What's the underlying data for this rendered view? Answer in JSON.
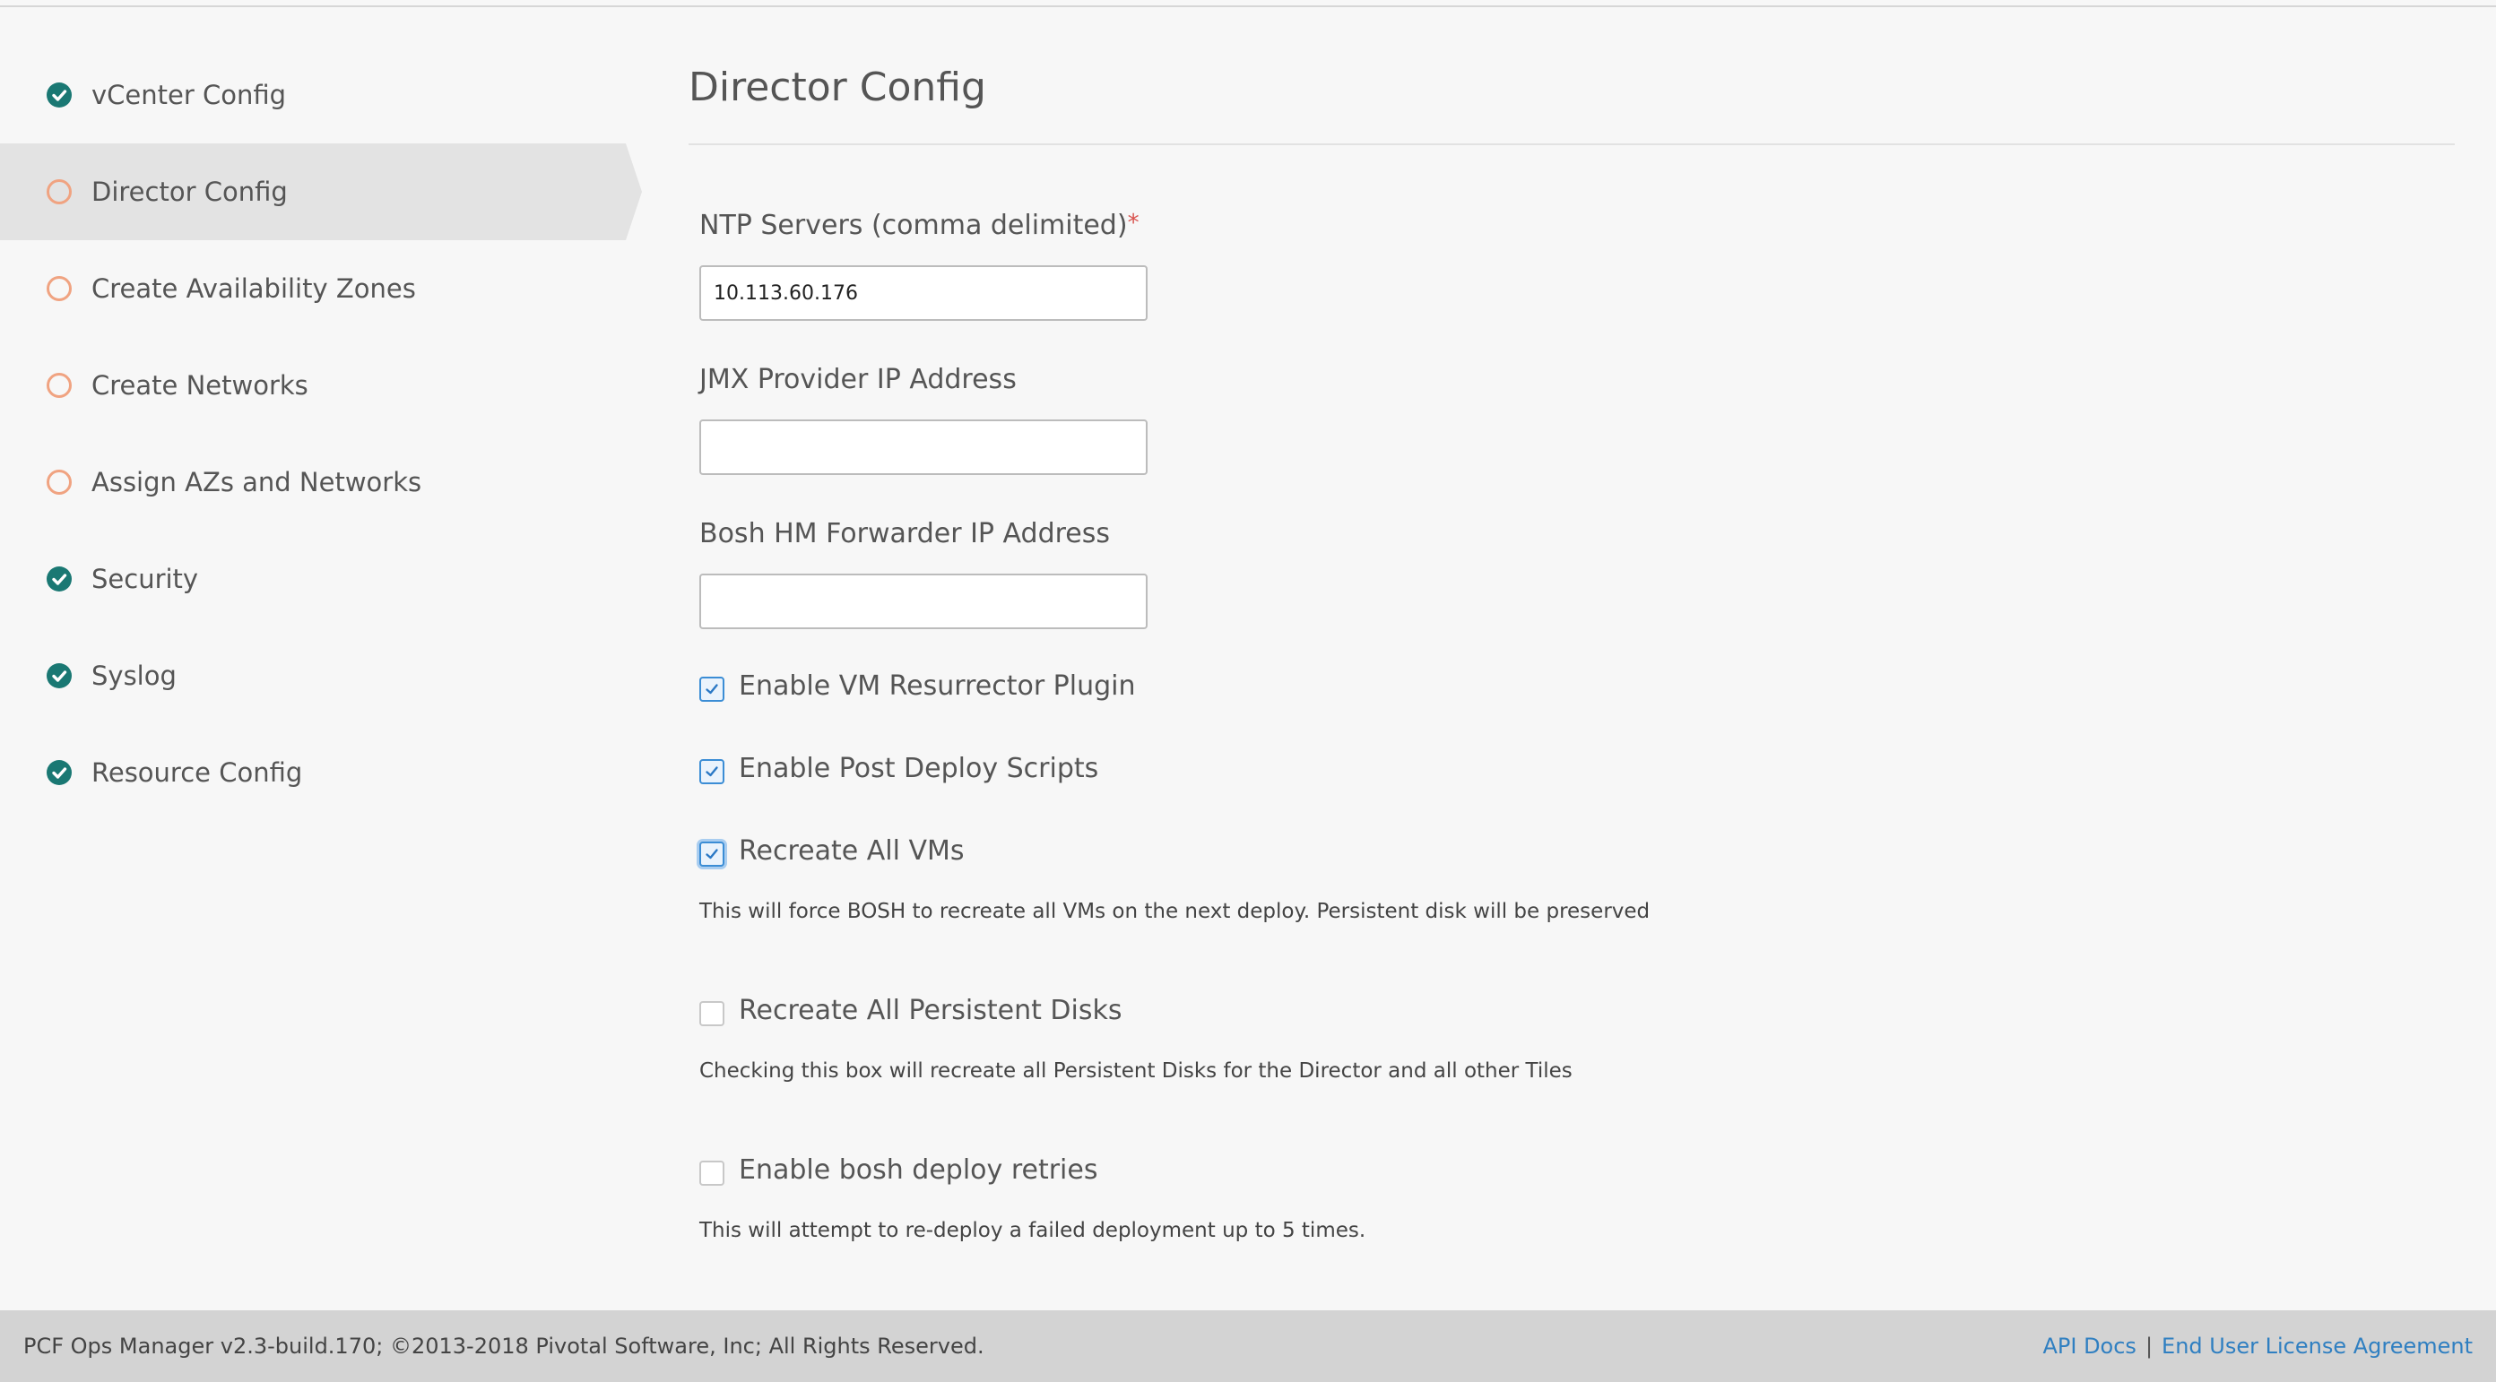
{
  "sidebar": {
    "items": [
      {
        "label": "vCenter Config",
        "status": "done"
      },
      {
        "label": "Director Config",
        "status": "todo",
        "active": true
      },
      {
        "label": "Create Availability Zones",
        "status": "todo"
      },
      {
        "label": "Create Networks",
        "status": "todo"
      },
      {
        "label": "Assign AZs and Networks",
        "status": "todo"
      },
      {
        "label": "Security",
        "status": "done"
      },
      {
        "label": "Syslog",
        "status": "done"
      },
      {
        "label": "Resource Config",
        "status": "done"
      }
    ]
  },
  "main": {
    "title": "Director Config",
    "ntp": {
      "label": "NTP Servers (comma delimited)",
      "required_mark": "*",
      "value": "10.113.60.176"
    },
    "jmx": {
      "label": "JMX Provider IP Address",
      "value": ""
    },
    "bosh_hm": {
      "label": "Bosh HM Forwarder IP Address",
      "value": ""
    },
    "checkboxes": {
      "resurrector": {
        "label": "Enable VM Resurrector Plugin",
        "checked": true
      },
      "post_deploy": {
        "label": "Enable Post Deploy Scripts",
        "checked": true
      },
      "recreate_vms": {
        "label": "Recreate All VMs",
        "checked": true,
        "help": "This will force BOSH to recreate all VMs on the next deploy. Persistent disk will be preserved"
      },
      "recreate_disks": {
        "label": "Recreate All Persistent Disks",
        "checked": false,
        "help": "Checking this box will recreate all Persistent Disks for the Director and all other Tiles"
      },
      "deploy_retries": {
        "label": "Enable bosh deploy retries",
        "checked": false,
        "help": "This will attempt to re-deploy a failed deployment up to 5 times."
      }
    }
  },
  "footer": {
    "copyright": "PCF Ops Manager v2.3-build.170; ©2013-2018 Pivotal Software, Inc; All Rights Reserved.",
    "api_docs": "API Docs",
    "separator": "|",
    "eula": "End User License Agreement"
  },
  "colors": {
    "done_icon": "#1a7873",
    "todo_icon": "#f0a381",
    "checkbox_checked": "#3b8dd5",
    "link": "#2f7fc1"
  }
}
